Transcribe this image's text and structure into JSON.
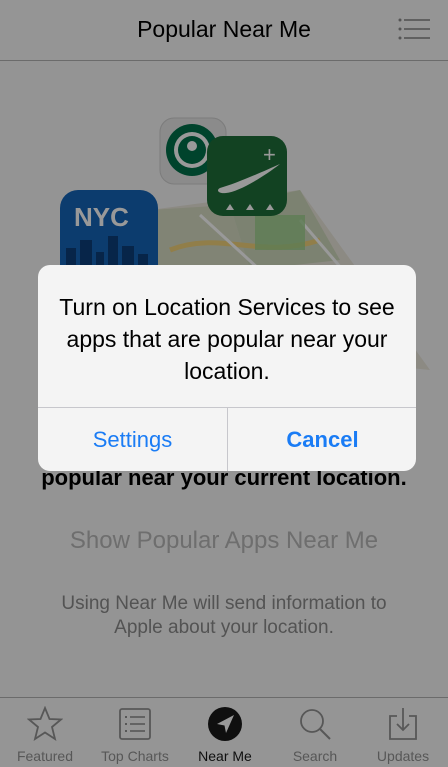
{
  "nav": {
    "title": "Popular Near Me",
    "icon": "list-icon"
  },
  "content": {
    "headline": "popular near your current location.",
    "show_button": "Show Popular Apps Near Me",
    "info": "Using Near Me will send information to Apple about your location."
  },
  "illustration": {
    "city_label": "NYC",
    "icons": [
      "starbucks-app-icon",
      "nike-plus-app-icon",
      "nyc-app-icon",
      "map-icon"
    ]
  },
  "tabs": [
    {
      "label": "Featured",
      "icon": "star-icon",
      "active": false
    },
    {
      "label": "Top Charts",
      "icon": "list-chart-icon",
      "active": false
    },
    {
      "label": "Near Me",
      "icon": "location-arrow-icon",
      "active": true
    },
    {
      "label": "Search",
      "icon": "search-icon",
      "active": false
    },
    {
      "label": "Updates",
      "icon": "download-tray-icon",
      "active": false
    }
  ],
  "alert": {
    "message": "Turn on Location Services to see apps that are popular near your location.",
    "settings_label": "Settings",
    "cancel_label": "Cancel"
  },
  "colors": {
    "accent": "#1a7cf5",
    "nike_green": "#1f6e3a",
    "starbucks_green": "#00704a",
    "nyc_blue": "#1565b8"
  }
}
